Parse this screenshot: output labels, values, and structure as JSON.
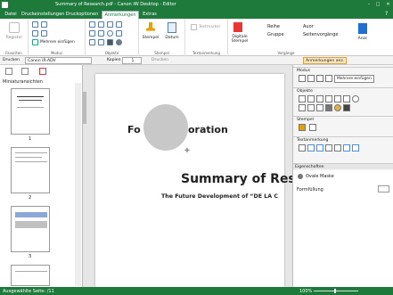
{
  "window": {
    "title": "Summary of Research.pdf - Canon iW Desktop - Editor"
  },
  "tabs": [
    "Datei",
    "Druckeinstellungen",
    "Druckoptionen",
    "Anmerkungen",
    "Extras"
  ],
  "ribbon": {
    "groups": [
      "Favoriten",
      "Modus",
      "Objekte",
      "Stempel",
      "Textanmerkung",
      "Vorgänge"
    ],
    "register_label": "Register",
    "mehrere_label": "Mehrere einfügen",
    "stempel_label": "Stempel",
    "datum_label": "Datum",
    "textmarker_label": "Textmarker",
    "digitale_stempel_label": "Digitale Stempel",
    "reihe_label": "Reihe",
    "gruppe_label": "Gruppe",
    "auor_label": "Auor",
    "seitenvorgaenge_label": "Seitenvorgänge",
    "anzeige_label": "Anzc"
  },
  "toolbar": {
    "drucken_label": "Drucken",
    "printer": "Canon iR-ADV",
    "kopien_label": "Kopien",
    "kopien_value": "1",
    "drucken_btn": "Drucken",
    "anmerkungen_anz": "Anmerkungen anz."
  },
  "left_panel": {
    "header": "Miniaturansichten",
    "pages": [
      "1",
      "2",
      "3"
    ]
  },
  "document": {
    "title_partial": "Fo",
    "subtitle_partial": "oration",
    "heading": "Summary of Rese",
    "subheading": "The Future Development of “DE LA C"
  },
  "right_panel": {
    "modus_label": "Modus",
    "mehrere_label": "Mehrere einfügen",
    "objekte_label": "Objekte",
    "stempel_label": "Stempel",
    "textanmerkung_label": "Textanmerkung",
    "eigenschaften_label": "Eigenschaften",
    "ovale_maske_label": "Ovale Maske",
    "formfuellung_label": "Formfüllung"
  },
  "status": {
    "left": "Ausgewählte Seite: /11",
    "zoom": "100%"
  },
  "colors": {
    "brand": "#1e7a3a",
    "shape": "#c8c8c8"
  }
}
